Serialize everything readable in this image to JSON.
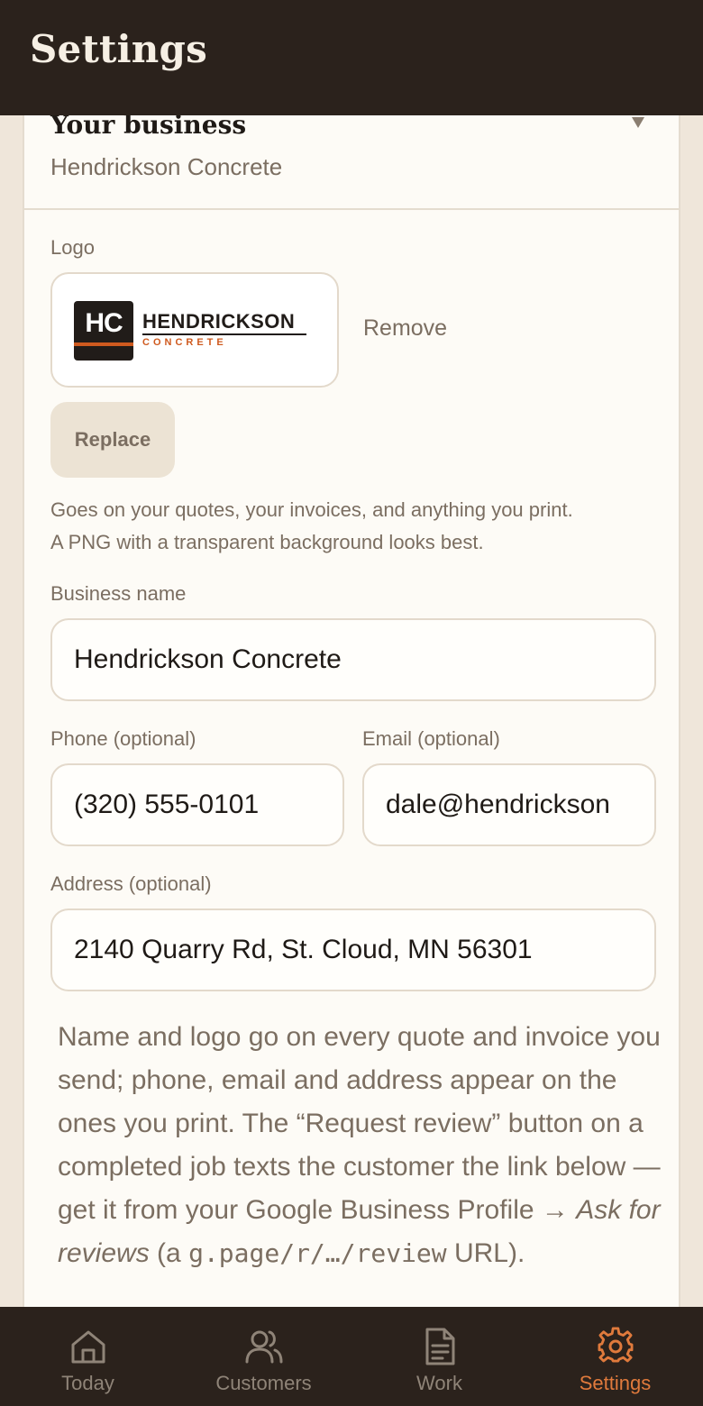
{
  "header": {
    "title": "Settings"
  },
  "section": {
    "title": "Your business",
    "subtitle": "Hendrickson Concrete"
  },
  "logo": {
    "label": "Logo",
    "mark": "HC",
    "name": "HENDRICKSON",
    "tagline": "CONCRETE",
    "remove_label": "Remove",
    "replace_label": "Replace",
    "help_line1": "Goes on your quotes, your invoices, and anything you print.",
    "help_line2": "A PNG with a transparent background looks best."
  },
  "fields": {
    "business_name": {
      "label": "Business name",
      "value": "Hendrickson Concrete"
    },
    "phone": {
      "label": "Phone (optional)",
      "value": "(320) 555-0101"
    },
    "email": {
      "label": "Email (optional)",
      "value": "dale@hendrickson"
    },
    "address": {
      "label": "Address (optional)",
      "value": "2140 Quarry Rd, St. Cloud, MN 56301"
    }
  },
  "note": {
    "part1": "Name and logo go on every quote and invoice you send; phone, email and address appear on the ones you print. The “Request review” button on a completed job texts the customer the link below — get it from your Google Business Profile → ",
    "emphasis": "Ask for reviews",
    "part2": " (a ",
    "code": "g.page/r/…/review",
    "part3": " URL)."
  },
  "tabs": [
    {
      "label": "Today",
      "icon": "home-icon"
    },
    {
      "label": "Customers",
      "icon": "users-icon"
    },
    {
      "label": "Work",
      "icon": "document-icon"
    },
    {
      "label": "Settings",
      "icon": "gear-icon"
    }
  ],
  "colors": {
    "header_bg": "#2b221c",
    "accent": "#e07a3c",
    "card_bg": "#fdfbf6",
    "page_bg": "#efe6da"
  }
}
